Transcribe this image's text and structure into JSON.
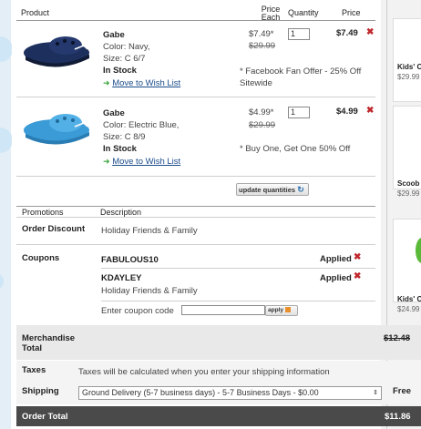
{
  "header": {
    "product": "Product",
    "price_each": [
      "Price",
      "Each"
    ],
    "quantity": "Quantity",
    "price": "Price"
  },
  "items": [
    {
      "name": "Gabe",
      "color": "Color: Navy,",
      "size": "Size: C 6/7",
      "stock": "In Stock",
      "wish_link": "Move to Wish List",
      "price_each": "$7.49*",
      "orig_price": "$29.99",
      "qty": "1",
      "total": "$7.49",
      "offer": "* Facebook Fan Offer - 25% Off Sitewide"
    },
    {
      "name": "Gabe",
      "color": "Color: Electric Blue,",
      "size": "Size: C 8/9",
      "stock": "In Stock",
      "wish_link": "Move to Wish List",
      "price_each": "$4.99*",
      "orig_price": "$29.99",
      "qty": "1",
      "total": "$4.99",
      "offer": "* Buy One, Get One 50% Off"
    }
  ],
  "update_button": "update quantities",
  "promotions": {
    "col_promotions": "Promotions",
    "col_description": "Description",
    "order_discount_label": "Order Discount",
    "order_discount_desc": "Holiday Friends & Family",
    "coupons_label": "Coupons",
    "coupons": [
      {
        "code": "FABULOUS10",
        "status": "Applied",
        "desc": ""
      },
      {
        "code": "KDAYLEY",
        "status": "Applied",
        "desc": "Holiday Friends & Family"
      }
    ],
    "enter_coupon_label": "Enter coupon code",
    "coupon_placeholder": "",
    "apply_label": "apply"
  },
  "summary": {
    "merch_label": "Merchandise Total",
    "merch_value": "$12.48",
    "taxes_label": "Taxes",
    "taxes_text": "Taxes will be calculated when you enter your shipping information",
    "shipping_label": "Shipping",
    "shipping_option": "Ground Delivery (5-7 business days) - 5-7 Business Days - $0.00",
    "shipping_value": "Free",
    "order_total_label": "Order Total",
    "order_total_value": "$11.86"
  },
  "sidebar": [
    {
      "label": "Kids' C",
      "price": "$29.99"
    },
    {
      "label": "Scoob",
      "price": "$29.99"
    },
    {
      "label": "Kids' C",
      "price": "$24.99"
    }
  ],
  "colors": {
    "navy": "#1d2f5c",
    "electric_blue": "#3b9bd6",
    "remove_red": "#c0272d",
    "link_blue": "#1b4c8a"
  }
}
